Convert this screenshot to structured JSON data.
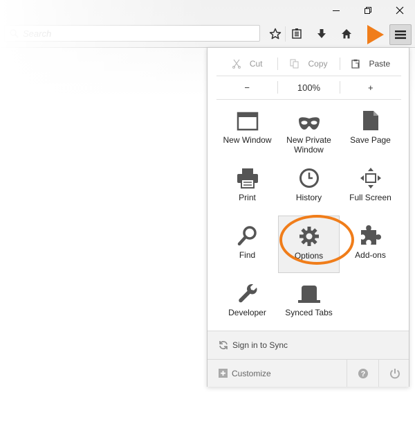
{
  "search": {
    "placeholder": "Search"
  },
  "menu": {
    "edit": {
      "cut": "Cut",
      "copy": "Copy",
      "paste": "Paste"
    },
    "zoom": {
      "minus": "−",
      "level": "100%",
      "plus": "+"
    },
    "tiles": [
      {
        "label": "New Window",
        "icon": "new-window-icon"
      },
      {
        "label": "New Private Window",
        "icon": "private-mask-icon"
      },
      {
        "label": "Save Page",
        "icon": "save-page-icon"
      },
      {
        "label": "Print",
        "icon": "printer-icon"
      },
      {
        "label": "History",
        "icon": "clock-icon"
      },
      {
        "label": "Full Screen",
        "icon": "fullscreen-icon"
      },
      {
        "label": "Find",
        "icon": "magnifier-icon"
      },
      {
        "label": "Options",
        "icon": "gear-icon"
      },
      {
        "label": "Add-ons",
        "icon": "puzzle-icon"
      },
      {
        "label": "Developer",
        "icon": "wrench-icon"
      },
      {
        "label": "Synced Tabs",
        "icon": "synced-tabs-icon"
      }
    ],
    "sync_label": "Sign in to Sync",
    "customize_label": "Customize"
  },
  "colors": {
    "highlight": "#f07d1a",
    "icon": "#555555"
  }
}
